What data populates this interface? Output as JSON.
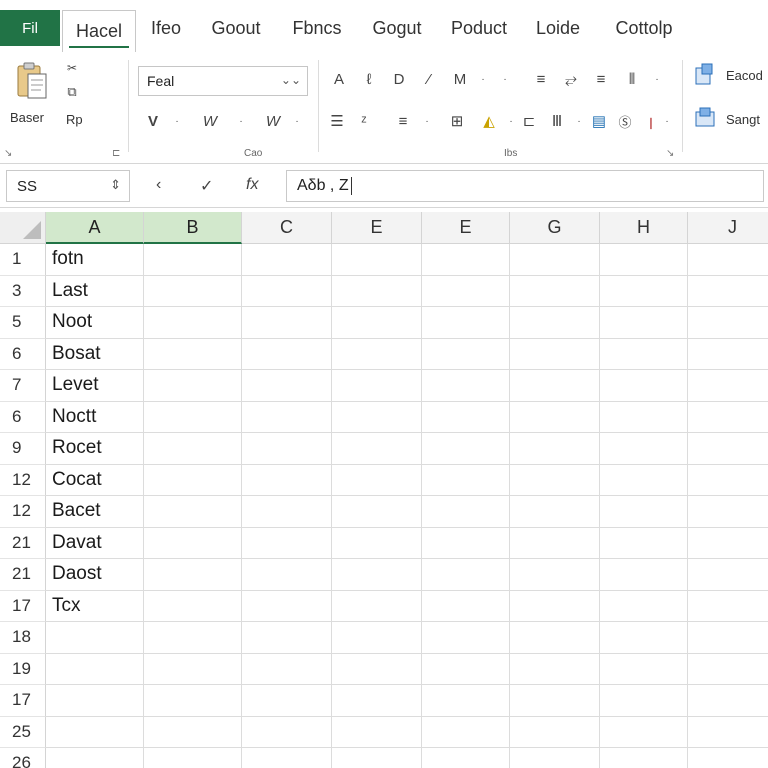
{
  "ribbon_tabs": [
    {
      "label": "Fil",
      "active": false
    },
    {
      "label": "Hacel",
      "active": true
    },
    {
      "label": "Ifeo",
      "active": false
    },
    {
      "label": "Goout",
      "active": false
    },
    {
      "label": "Fbncs",
      "active": false
    },
    {
      "label": "Gogut",
      "active": false
    },
    {
      "label": "Poduct",
      "active": false
    },
    {
      "label": "Loide",
      "active": false
    },
    {
      "label": "Cottolp",
      "active": false
    }
  ],
  "ribbon": {
    "clipboard": {
      "paste_label": "Baser",
      "copy_label": "Rp",
      "group_label": ""
    },
    "font": {
      "font_name": "Feal",
      "group_label": "Cao"
    },
    "alignment": {
      "group_label": "Ibs"
    },
    "styles": {
      "item1": "Eacod",
      "item2": "Sangt"
    }
  },
  "formula_bar": {
    "name_box": "SS",
    "cancel_symbol": "‹",
    "enter_symbol": "✓",
    "fx_symbol": "fx",
    "formula": "Aδb , Z"
  },
  "grid": {
    "columns": [
      "A",
      "B",
      "C",
      "E",
      "E",
      "G",
      "H",
      "J"
    ],
    "selected_column": 0,
    "rows": [
      {
        "header": "1",
        "a": "fotn"
      },
      {
        "header": "3",
        "a": "Last"
      },
      {
        "header": "5",
        "a": "Noot"
      },
      {
        "header": "6",
        "a": "Bosat"
      },
      {
        "header": "7",
        "a": "Levet"
      },
      {
        "header": "6",
        "a": "Noctt"
      },
      {
        "header": "9",
        "a": "Rocet"
      },
      {
        "header": "12",
        "a": "Cocat"
      },
      {
        "header": "12",
        "a": "Bacet"
      },
      {
        "header": "21",
        "a": "Davat"
      },
      {
        "header": "21",
        "a": "Daost"
      },
      {
        "header": "17",
        "a": "Tcx"
      },
      {
        "header": "18",
        "a": ""
      },
      {
        "header": "19",
        "a": ""
      },
      {
        "header": "17",
        "a": ""
      },
      {
        "header": "25",
        "a": ""
      },
      {
        "header": "26",
        "a": ""
      }
    ]
  },
  "colors": {
    "accent": "#217346",
    "selected_header": "#d2e8cc"
  }
}
